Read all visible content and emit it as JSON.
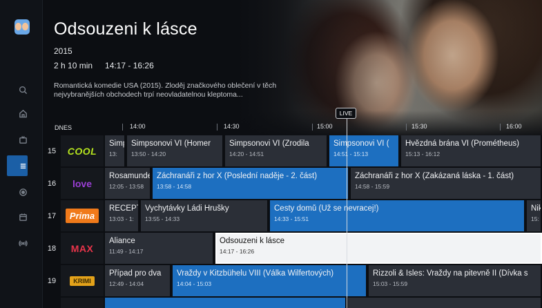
{
  "program": {
    "title": "Odsouzeni k lásce",
    "year": "2015",
    "duration": "2 h 10 min",
    "time": "14:17 - 16:26",
    "description": "Romantická komedie USA (2015). Zloděj značkového oblečení v těch nejvybranějších obchodech trpí neovladatelnou kleptoma..."
  },
  "timeline": {
    "day": "DNES",
    "ticks": [
      "14:00",
      "14:30",
      "15:00",
      "15:30",
      "16:00"
    ],
    "live_label": "LIVE"
  },
  "sidebar": {
    "items": [
      {
        "icon": "search-icon"
      },
      {
        "icon": "home-icon"
      },
      {
        "icon": "tv-icon"
      },
      {
        "icon": "guide-list-icon",
        "active": true
      },
      {
        "icon": "record-icon"
      },
      {
        "icon": "calendar-icon"
      },
      {
        "icon": "broadcast-icon"
      }
    ]
  },
  "channels": [
    {
      "number": "15",
      "logo": "COOL",
      "logo_color": "#b6e51e",
      "programs": [
        {
          "title": "Simpsonovi VI",
          "time": "13:",
          "style": "dark"
        },
        {
          "title": "Simpsonovi VI (Homer",
          "time": "13:50 - 14:20",
          "style": "dark"
        },
        {
          "title": "Simpsonovi VI (Zrodila",
          "time": "14:20 - 14:51",
          "style": "dark"
        },
        {
          "title": "Simpsonovi VI (",
          "time": "14:51 - 15:13",
          "style": "blue"
        },
        {
          "title": "Hvězdná brána VI (Prométheus)",
          "time": "15:13 - 16:12",
          "style": "dark"
        }
      ]
    },
    {
      "number": "16",
      "logo": "love",
      "logo_color": "#9b3fd6",
      "programs": [
        {
          "title": "Rosamunde",
          "time": "12:05 - 13:58",
          "style": "dark"
        },
        {
          "title": "Záchranáři z hor X (Poslední naděje - 2. část)",
          "time": "13:58 - 14:58",
          "style": "blue"
        },
        {
          "title": "Záchranáři z hor X (Zakázaná láska - 1. část)",
          "time": "14:58 - 15:59",
          "style": "dark"
        }
      ]
    },
    {
      "number": "17",
      "logo": "Prima",
      "logo_color": "#f07a1a",
      "programs": [
        {
          "title": "RECEPT",
          "time": "13:03 - 1:",
          "style": "dark"
        },
        {
          "title": "Vychytávky Ládi Hrušky",
          "time": "13:55 - 14:33",
          "style": "dark"
        },
        {
          "title": "Cesty domů (Už se nevracej!)",
          "time": "14:33 - 15:51",
          "style": "blue"
        },
        {
          "title": "Nik",
          "time": "15:",
          "style": "dark"
        }
      ]
    },
    {
      "number": "18",
      "logo": "MAX",
      "logo_color": "#e8344a",
      "programs": [
        {
          "title": "Aliance",
          "time": "11:49 - 14:17",
          "style": "dark"
        },
        {
          "title": "Odsouzeni k lásce",
          "time": "14:17 - 16:26",
          "style": "white"
        }
      ]
    },
    {
      "number": "19",
      "logo": "KRIMI",
      "logo_color": "#e3a21a",
      "programs": [
        {
          "title": "Případ pro dva",
          "time": "12:49 - 14:04",
          "style": "dark"
        },
        {
          "title": "Vraždy v Kitzbühelu VIII (Válka Wilfertových)",
          "time": "14:04 - 15:03",
          "style": "blue"
        },
        {
          "title": "Rizzoli & Isles: Vraždy na pitevně II (Dívka s",
          "time": "15:03 - 15:59",
          "style": "dark"
        }
      ]
    }
  ],
  "colors": {
    "accent": "#1d6fc0",
    "program_bg": "#2b2f37",
    "selected_bg": "#f2f3f5",
    "background": "#0c0e12"
  }
}
